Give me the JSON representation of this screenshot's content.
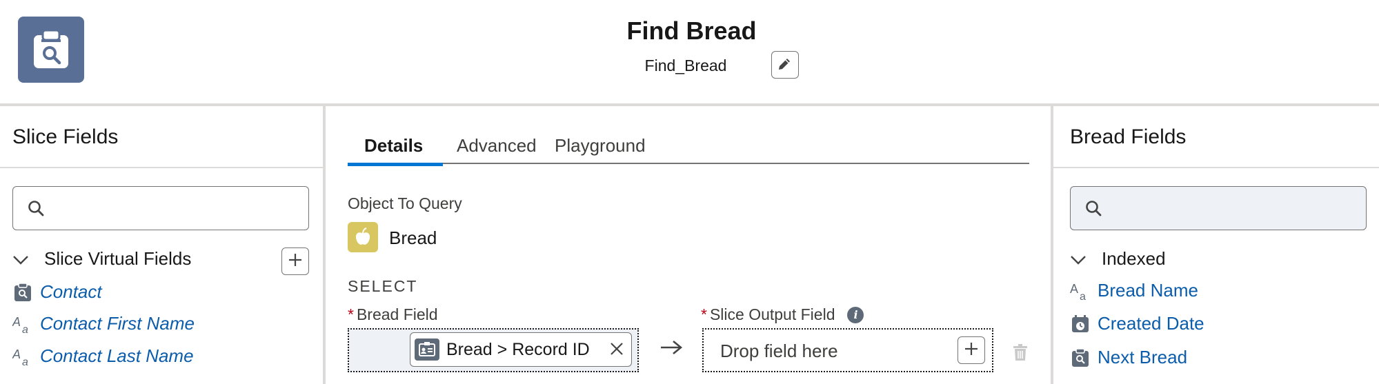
{
  "header": {
    "title": "Find Bread",
    "api_name": "Find_Bread",
    "app_icon": "clipboard-search-icon",
    "edit_icon": "pencil-icon"
  },
  "left_panel": {
    "title": "Slice Fields",
    "search": {
      "value": "",
      "placeholder": ""
    },
    "section": {
      "label": "Slice Virtual Fields",
      "expanded": true
    },
    "fields": [
      {
        "label": "Contact",
        "icon": "clipboard-search-icon"
      },
      {
        "label": "Contact First Name",
        "icon": "text-field-icon"
      },
      {
        "label": "Contact Last Name",
        "icon": "text-field-icon"
      }
    ]
  },
  "center_panel": {
    "tabs": [
      {
        "label": "Details",
        "active": true
      },
      {
        "label": "Advanced",
        "active": false
      },
      {
        "label": "Playground",
        "active": false
      }
    ],
    "object_to_query_label": "Object To Query",
    "object_name": "Bread",
    "select_label": "SELECT",
    "bread_field_label": "Bread Field",
    "bread_field_value": "Bread > Record ID",
    "slice_output_label": "Slice Output Field",
    "drop_placeholder": "Drop field here",
    "required_marker": "*"
  },
  "right_panel": {
    "title": "Bread Fields",
    "search": {
      "value": "",
      "placeholder": ""
    },
    "section": {
      "label": "Indexed",
      "expanded": true
    },
    "fields": [
      {
        "label": "Bread Name",
        "icon": "text-field-icon"
      },
      {
        "label": "Created Date",
        "icon": "calendar-clock-icon"
      },
      {
        "label": "Next Bread",
        "icon": "clipboard-search-icon"
      }
    ]
  },
  "colors": {
    "accent": "#0176d3",
    "link": "#0b5cab",
    "app_icon_bg": "#5a6f96",
    "object_icon_bg": "#d8c760",
    "required": "#ba0517"
  }
}
